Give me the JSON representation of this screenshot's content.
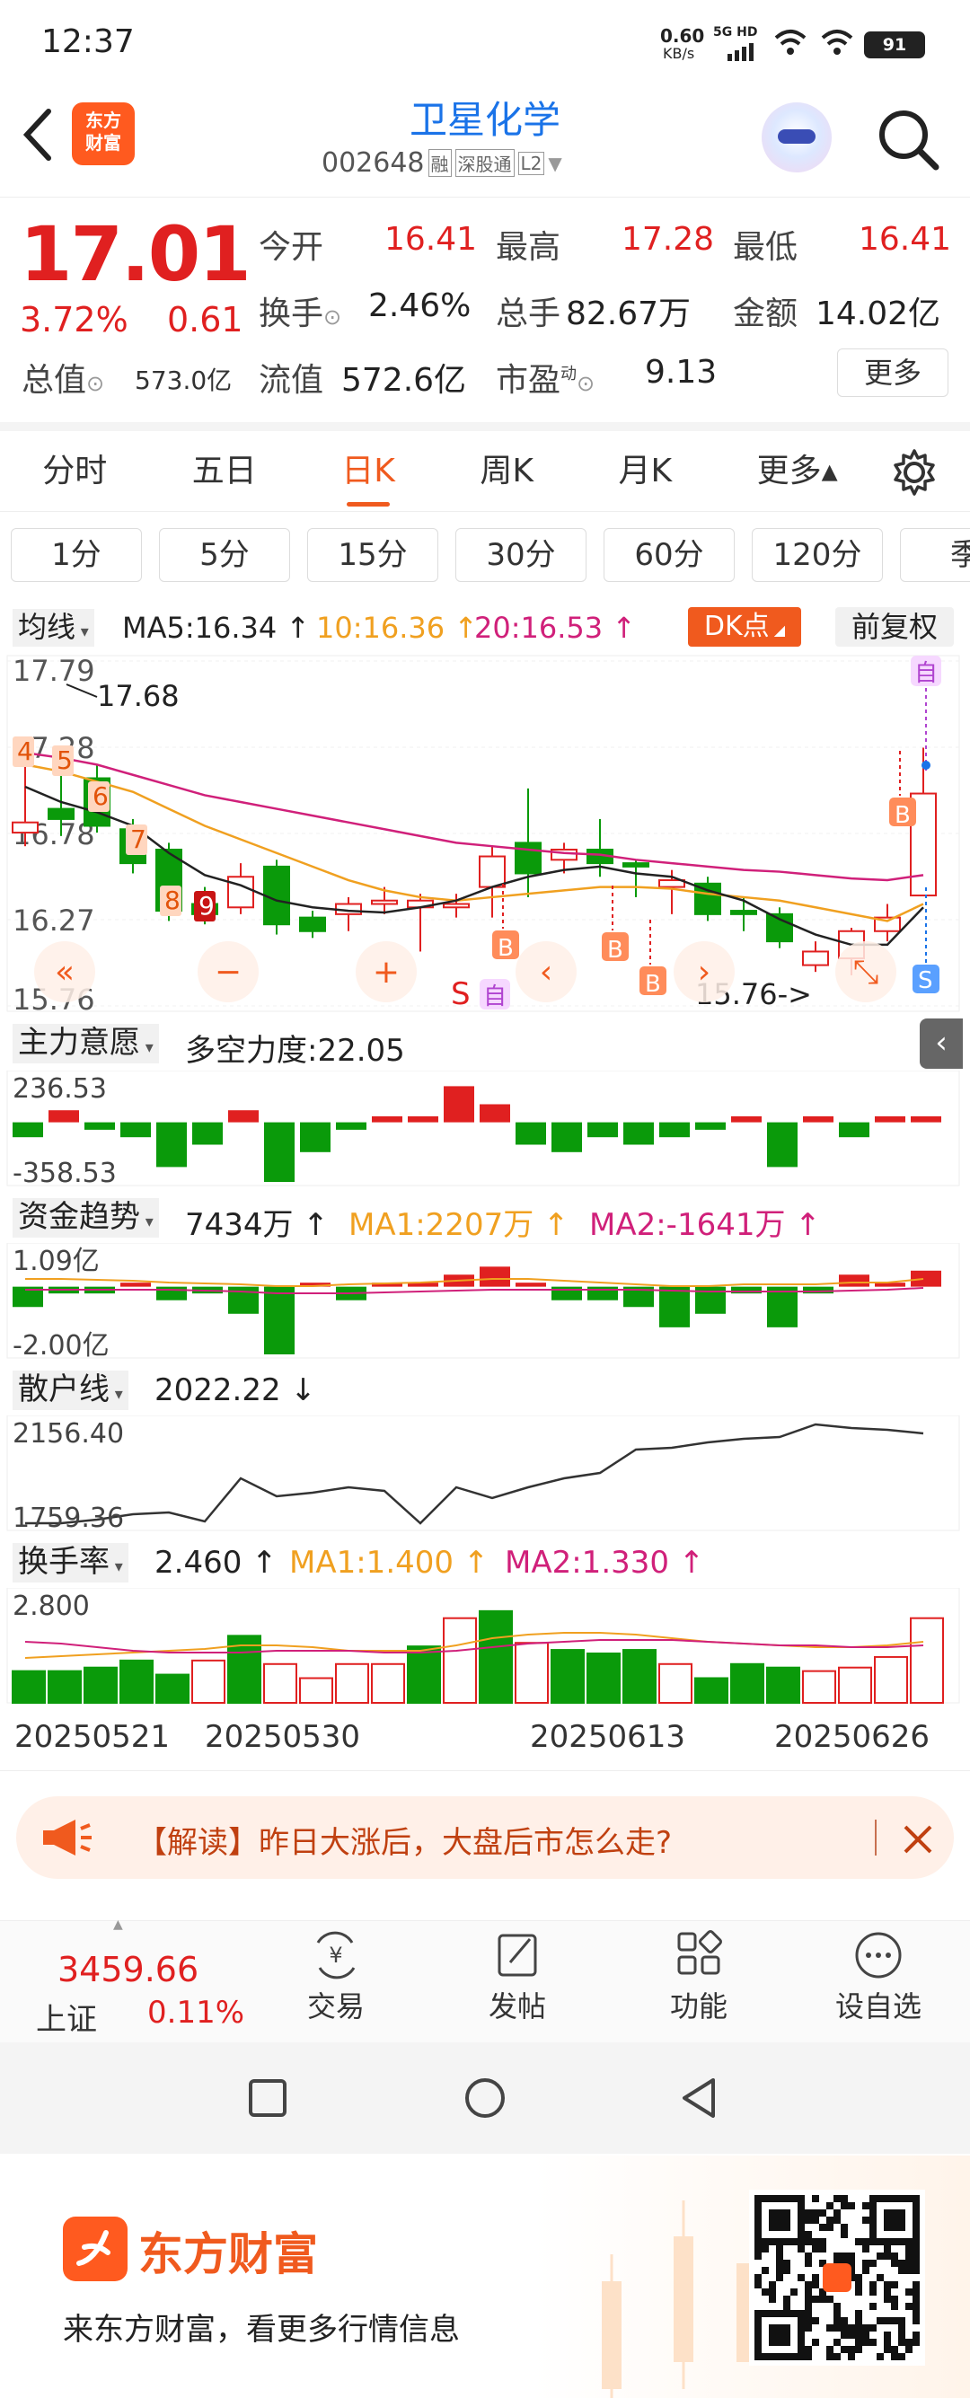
{
  "status": {
    "time": "12:37",
    "net_speed": "0.60",
    "net_unit": "KB/s",
    "net_type": "5G HD",
    "battery": "91"
  },
  "header": {
    "logo_line1": "东方",
    "logo_line2": "财富",
    "title": "卫星化学",
    "code": "002648",
    "tags": [
      "融",
      "深股通",
      "L2"
    ]
  },
  "quote": {
    "price": "17.01",
    "pct": "3.72%",
    "chg": "0.61",
    "open_label": "今开",
    "open": "16.41",
    "high_label": "最高",
    "high": "17.28",
    "low_label": "最低",
    "low": "16.41",
    "turnover_label": "换手",
    "turnover": "2.46%",
    "vol_label": "总手",
    "vol": "82.67万",
    "amt_label": "金额",
    "amt": "14.02亿",
    "mktcap_label": "总值",
    "mktcap": "573.0亿",
    "float_label": "流值",
    "float": "572.6亿",
    "pe_label": "市盈",
    "pe_sup": "动",
    "pe": "9.13",
    "more": "更多"
  },
  "period_tabs": [
    "分时",
    "五日",
    "日K",
    "周K",
    "月K",
    "更多▴"
  ],
  "active_period": "日K",
  "minute_tabs": [
    "1分",
    "5分",
    "15分",
    "30分",
    "60分",
    "120分",
    "季"
  ],
  "ma_bar": {
    "label": "均线",
    "ma5": "MA5:16.34 ↑",
    "ma10": "10:16.36 ↑",
    "ma20": "20:16.53 ↑",
    "dk": "DK点",
    "fq": "前复权"
  },
  "kline": {
    "yticks": [
      "17.79",
      "17.28",
      "16.78",
      "16.27",
      "15.76"
    ],
    "high_note": "17.68",
    "low_note": "15.76->",
    "sig_labels": [
      "4",
      "5",
      "6",
      "7",
      "8",
      "9"
    ],
    "zi": "自",
    "s": "S",
    "b": "B"
  },
  "panel1": {
    "label": "主力意愿",
    "value": "多空力度:22.05",
    "top": "236.53",
    "bottom": "-358.53"
  },
  "panel2": {
    "label": "资金趋势",
    "value": "7434万 ↑",
    "ma1": "MA1:2207万 ↑",
    "ma2": "MA2:-1641万 ↑",
    "top": "1.09亿",
    "bottom": "-2.00亿"
  },
  "panel3": {
    "label": "散户线",
    "value": "2022.22 ↓",
    "top": "2156.40",
    "bottom": "1759.36"
  },
  "panel4": {
    "label": "换手率",
    "value": "2.460 ↑",
    "ma1": "MA1:1.400 ↑",
    "ma2": "MA2:1.330 ↑",
    "top": "2.800"
  },
  "dates": [
    "20250521",
    "20250530",
    "20250613",
    "20250626"
  ],
  "banner": {
    "text": "【解读】昨日大涨后，大盘后市怎么走?"
  },
  "bottom_nav": {
    "index_value": "3459.66",
    "index_name": "上证",
    "index_pct": "0.11%",
    "items": [
      "交易",
      "发帖",
      "功能",
      "设自选"
    ]
  },
  "footer": {
    "brand": "东方财富",
    "slogan": "来东方财富，看更多行情信息"
  },
  "colors": {
    "up": "#e02020",
    "down": "#0a9a0a",
    "ma5": "#222222",
    "ma10": "#f0a020",
    "ma20": "#d0207a",
    "accent": "#ff6a1a",
    "blue": "#1a73e8"
  }
}
